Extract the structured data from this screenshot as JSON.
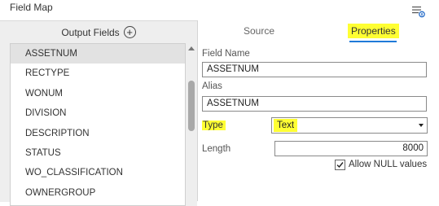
{
  "window": {
    "title": "Field Map",
    "menu_icon": "list-settings-icon"
  },
  "left": {
    "header_label": "Output Fields",
    "add_icon": "plus-circle-icon",
    "fields": [
      "ASSETNUM",
      "RECTYPE",
      "WONUM",
      "DIVISION",
      "DESCRIPTION",
      "STATUS",
      "WO_CLASSIFICATION",
      "OWNERGROUP"
    ],
    "selected_index": 0
  },
  "tabs": {
    "source": "Source",
    "properties": "Properties",
    "active": "properties"
  },
  "properties": {
    "field_name_label": "Field Name",
    "field_name_value": "ASSETNUM",
    "alias_label": "Alias",
    "alias_value": "ASSETNUM",
    "type_label": "Type",
    "type_value": "Text",
    "length_label": "Length",
    "length_value": "8000",
    "allow_null_label": "Allow NULL values",
    "allow_null_checked": true
  },
  "colors": {
    "highlight": "#ffff33",
    "tab_accent": "#1f7ad8",
    "panel_bg": "#eeeeee"
  }
}
